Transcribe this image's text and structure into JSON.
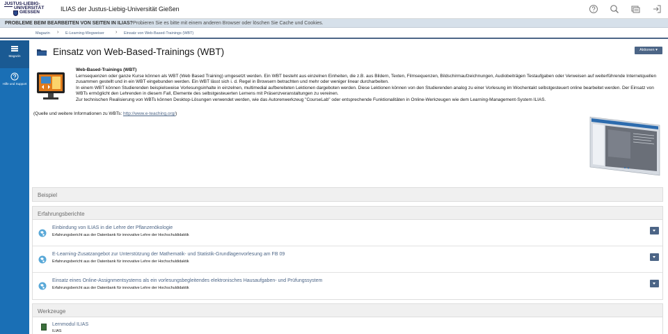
{
  "header": {
    "logo_line1": "JUSTUS-LIEBIG-",
    "logo_line2": "UNIVERSITÄT",
    "logo_line3": "GIESSEN",
    "site_title": "ILIAS der Justus-Liebig-Universität Gießen",
    "icons": [
      "help-icon",
      "search-icon",
      "notifications-icon",
      "logout-icon"
    ]
  },
  "notice": {
    "title": "PROBLEME BEIM BEARBEITEN VON SEITEN IN ILIAS?",
    "text": "Probieren Sie es bitte mit einem anderen Browser oder löschen Sie Cache und Cookies."
  },
  "breadcrumb": [
    "Magazin",
    "E-Learning-Wegweiser",
    "Einsatz von Web-Based-Trainings (WBT)"
  ],
  "mainbar": [
    {
      "label": "Magazin",
      "icon": "repository-icon",
      "active": true
    },
    {
      "label": "Hilfe und Support",
      "icon": "help-support-icon",
      "active": false
    }
  ],
  "page": {
    "title": "Einsatz von Web-Based-Trainings (WBT)",
    "actions_label": "Aktionen ▾"
  },
  "description": {
    "title": "Web-Based-Trainings (WBT)",
    "p1": "Lernsequenzen oder ganze Kurse können als WBT (Web Based Training) umgesetzt werden. Ein WBT besteht aus einzelnen Einheiten, die z.B. aus Bildern, Texten, Filmsequenzen, Bildschirmaufzeichnungen, Audiobeiträgen Testaufgaben oder Verweisen auf weiterführende Internetquellen zusammen gestellt und in ein WBT eingebunden werden. Ein WBT lässt sich i. d. Regel in Browsern betrachten und mehr oder weniger linear durcharbeiten.",
    "p2": "In einem WBT können Studierenden beispielsweise Vorlesungsinhalte in einzelnen, multimedial aufbereiteten Lektionen dargeboten werden. Diese Lektionen können von den Studierenden analog zu einer Vorlesung im Wochentakt selbstgesteuert online bearbeitet werden. Der Einsatz von WBTs ermöglicht den Lehrenden in diesem Fall, Elemente des selbstgesteuerten Lernens mit Präsenzveranstaltungen zu vereinen.",
    "p3": "Zur technischen Realisierung von WBTs können Desktop-Lösungen verwendet werden, wie das Autorenwerkzeug \"CourseLab\" oder entsprechende Funktionalitäten in Online-Werkzeugen wie dem Learning-Management-System ILIAS.",
    "source_prefix": "(Quelle und weitere Informationen zu WBTs: ",
    "source_link": "http://www.e-teaching.org/",
    "source_suffix": ")"
  },
  "panels": {
    "beispiel": {
      "title": "Beispiel"
    },
    "erfahrungsberichte": {
      "title": "Erfahrungsberichte",
      "items": [
        {
          "title": "Einbindung von ILIAS in die Lehre der Pflanzenökologie",
          "subtitle": "Erfahrungsbericht aus der Datenbank für innovative Lehre der Hochschuldidaktik"
        },
        {
          "title": "E-Learning-Zusatzangebot zur Unterstützung der Mathematik- und Statistik-Grundlagenvorlesung am FB 09",
          "subtitle": "Erfahrungsbericht aus der Datenbank für innovative Lehre der Hochschuldidaktik"
        },
        {
          "title": "Einsatz eines Online-Assignmentsystems als ein vorlesungsbegleitendes elektronisches Hausaufgaben- und Prüfungssystem",
          "subtitle": "Erfahrungsbericht aus der Datenbank für innovative Lehre der Hochschuldidaktik"
        }
      ]
    },
    "werkzeuge": {
      "title": "Werkzeuge",
      "items": [
        {
          "title": "Lernmodul ILIAS",
          "subtitle": "ILIAS"
        }
      ]
    }
  },
  "colors": {
    "mainbar": "#1a6fb5",
    "link": "#4c6586",
    "notice_bg": "#d6e0ea",
    "button": "#4c6586"
  }
}
